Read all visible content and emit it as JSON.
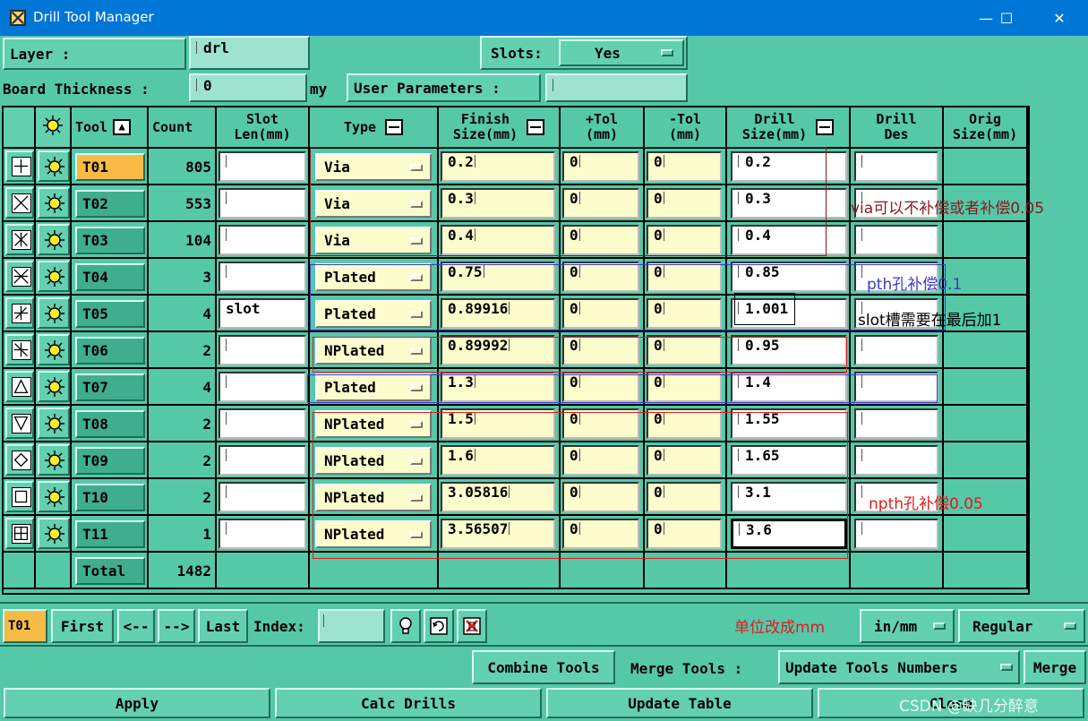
{
  "window": {
    "title": "Drill Tool Manager",
    "minimize": "—",
    "maximize": "☐",
    "close": "✕"
  },
  "form": {
    "layer_label": "Layer           :",
    "layer_value": "drl",
    "slots_label": "Slots:",
    "slots_value": "Yes",
    "board_thickness_label": "Board Thickness :",
    "board_thickness_value": "0",
    "board_thickness_unit": "my",
    "user_params_label": "User Parameters :",
    "user_params_value": ""
  },
  "table": {
    "headers": {
      "tool": "Tool",
      "count": "Count",
      "slot_len": [
        "Slot",
        "Len(mm)"
      ],
      "type": "Type",
      "finish": [
        "Finish",
        "Size(mm)"
      ],
      "plus_tol": [
        "+Tol",
        "(mm)"
      ],
      "minus_tol": [
        "-Tol",
        "(mm)"
      ],
      "drill_size": [
        "Drill",
        "Size(mm)"
      ],
      "drill_des": [
        "Drill",
        "Des"
      ],
      "orig_size": [
        "Orig",
        "Size(mm)"
      ]
    },
    "rows": [
      {
        "tool": "T01",
        "count": "805",
        "slot": "",
        "type": "Via",
        "finish": "0.2",
        "ptol": "0",
        "mtol": "0",
        "drill": "0.2",
        "des": "",
        "symbol": "plus"
      },
      {
        "tool": "T02",
        "count": "553",
        "slot": "",
        "type": "Via",
        "finish": "0.3",
        "ptol": "0",
        "mtol": "0",
        "drill": "0.3",
        "des": "",
        "symbol": "x"
      },
      {
        "tool": "T03",
        "count": "104",
        "slot": "",
        "type": "Via",
        "finish": "0.4",
        "ptol": "0",
        "mtol": "0",
        "drill": "0.4",
        "des": "",
        "symbol": "star"
      },
      {
        "tool": "T04",
        "count": "3",
        "slot": "",
        "type": "Plated",
        "finish": "0.75",
        "ptol": "0",
        "mtol": "0",
        "drill": "0.85",
        "des": "",
        "symbol": "xbar"
      },
      {
        "tool": "T05",
        "count": "4",
        "slot": "slot",
        "type": "Plated",
        "finish": "0.89916",
        "ptol": "0",
        "mtol": "0",
        "drill": "1.001",
        "des": "",
        "symbol": "plusx"
      },
      {
        "tool": "T06",
        "count": "2",
        "slot": "",
        "type": "NPlated",
        "finish": "0.89992",
        "ptol": "0",
        "mtol": "0",
        "drill": "0.95",
        "des": "",
        "symbol": "asterisk"
      },
      {
        "tool": "T07",
        "count": "4",
        "slot": "",
        "type": "Plated",
        "finish": "1.3",
        "ptol": "0",
        "mtol": "0",
        "drill": "1.4",
        "des": "",
        "symbol": "triangle"
      },
      {
        "tool": "T08",
        "count": "2",
        "slot": "",
        "type": "NPlated",
        "finish": "1.5",
        "ptol": "0",
        "mtol": "0",
        "drill": "1.55",
        "des": "",
        "symbol": "triangle-down"
      },
      {
        "tool": "T09",
        "count": "2",
        "slot": "",
        "type": "NPlated",
        "finish": "1.6",
        "ptol": "0",
        "mtol": "0",
        "drill": "1.65",
        "des": "",
        "symbol": "diamond"
      },
      {
        "tool": "T10",
        "count": "2",
        "slot": "",
        "type": "NPlated",
        "finish": "3.05816",
        "ptol": "0",
        "mtol": "0",
        "drill": "3.1",
        "des": "",
        "symbol": "square"
      },
      {
        "tool": "T11",
        "count": "1",
        "slot": "",
        "type": "NPlated",
        "finish": "3.56507",
        "ptol": "0",
        "mtol": "0",
        "drill": "3.6",
        "des": "",
        "symbol": "square-plus"
      }
    ],
    "total_label": "Total",
    "total_count": "1482"
  },
  "annotations": {
    "via": "via可以不补偿或者补偿0.05",
    "pth": "pth孔补偿0.1",
    "slot": "slot槽需要在最后加1",
    "npth": "npth孔补偿0.05",
    "unit": "单位改成mm"
  },
  "nav": {
    "current_tool": "T01",
    "first": "First",
    "prev": "<--",
    "next": "-->",
    "last": "Last",
    "index_label": "Index:",
    "index_value": "",
    "units": "in/mm",
    "mode": "Regular"
  },
  "actions": {
    "combine_tools": "Combine Tools",
    "merge_tools_label": "Merge Tools  :",
    "update_tools_numbers": "Update Tools Numbers",
    "merge": "Merge",
    "apply": "Apply",
    "calc_drills": "Calc Drills",
    "update_table": "Update Table",
    "close": "Close"
  },
  "watermark": "CSDN @缺几分醉意",
  "colors": {
    "titlebar": "#0076d6",
    "panel": "#55c8a8",
    "selected_tool": "#f7bb45",
    "field_yellow": "#fdfccc"
  }
}
